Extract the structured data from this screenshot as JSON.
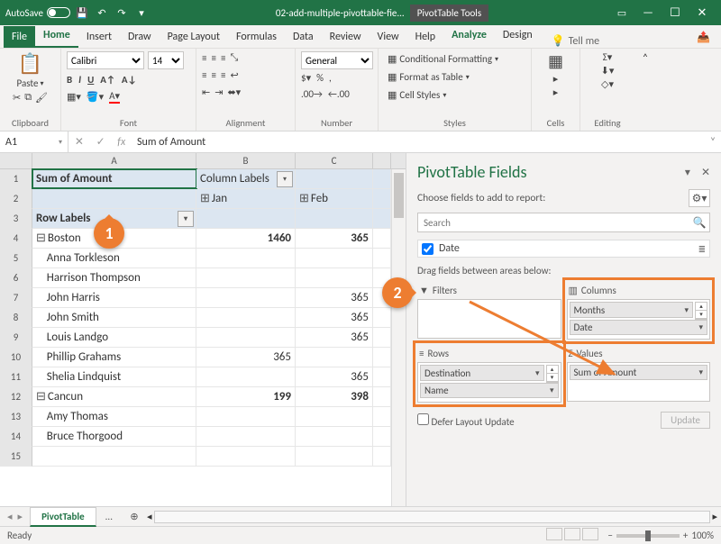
{
  "title_bar": {
    "autosave": "AutoSave",
    "doc_name": "02-add-multiple-pivottable-fie...",
    "context_tool": "PivotTable Tools"
  },
  "menu": {
    "file": "File",
    "home": "Home",
    "insert": "Insert",
    "draw": "Draw",
    "page_layout": "Page Layout",
    "formulas": "Formulas",
    "data": "Data",
    "review": "Review",
    "view": "View",
    "help": "Help",
    "analyze": "Analyze",
    "design": "Design",
    "tell_me": "Tell me"
  },
  "ribbon": {
    "paste": "Paste",
    "clipboard": "Clipboard",
    "font_name": "Calibri",
    "font_size": "14",
    "font_group": "Font",
    "alignment_group": "Alignment",
    "number_format": "General",
    "number_group": "Number",
    "cond_fmt": "Conditional Formatting",
    "fmt_table": "Format as Table",
    "cell_styles": "Cell Styles",
    "styles_group": "Styles",
    "cells_group": "Cells",
    "editing_group": "Editing"
  },
  "formula_bar": {
    "name_box": "A1",
    "formula": "Sum of Amount"
  },
  "pivot": {
    "a1": "Sum of Amount",
    "b1": "Column Labels",
    "a3": "Row Labels",
    "b2": "Jan",
    "c2": "Feb",
    "rows": [
      {
        "label": "Boston",
        "b": "1460",
        "c": "365",
        "group": true
      },
      {
        "label": "Anna Torkleson",
        "b": "",
        "c": ""
      },
      {
        "label": "Harrison Thompson",
        "b": "",
        "c": ""
      },
      {
        "label": "John Harris",
        "b": "",
        "c": "365"
      },
      {
        "label": "John Smith",
        "b": "",
        "c": "365"
      },
      {
        "label": "Louis Landgo",
        "b": "",
        "c": "365"
      },
      {
        "label": "Phillip Grahams",
        "b": "365",
        "c": ""
      },
      {
        "label": "Shelia Lindquist",
        "b": "",
        "c": "365"
      },
      {
        "label": "Cancun",
        "b": "199",
        "c": "398",
        "group": true
      },
      {
        "label": "Amy Thomas",
        "b": "",
        "c": ""
      },
      {
        "label": "Bruce Thorgood",
        "b": "",
        "c": ""
      }
    ]
  },
  "callouts": {
    "c1": "1",
    "c2": "2"
  },
  "pane": {
    "title": "PivotTable Fields",
    "choose": "Choose fields to add to report:",
    "search_ph": "Search",
    "field_date": "Date",
    "drag_hint": "Drag fields between areas below:",
    "filters": "Filters",
    "columns": "Columns",
    "rows": "Rows",
    "values": "Values",
    "col_items": [
      "Months",
      "Date"
    ],
    "row_items": [
      "Destination",
      "Name"
    ],
    "val_items": [
      "Sum of Amount"
    ],
    "defer": "Defer Layout Update",
    "update": "Update"
  },
  "sheet_tab": "PivotTable",
  "sheet_tab2": "...",
  "status": {
    "ready": "Ready",
    "zoom": "100%"
  }
}
